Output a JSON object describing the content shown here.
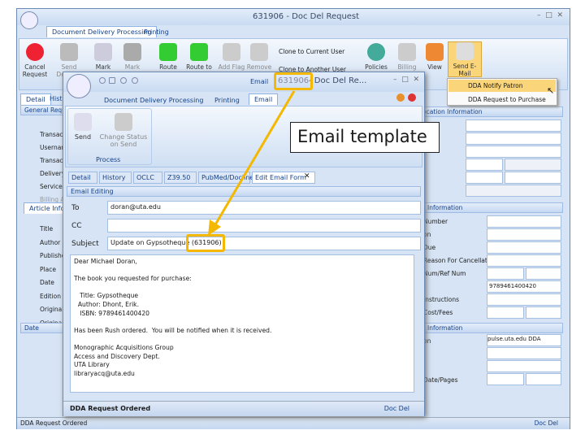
{
  "main_window": {
    "title": "631906 - Doc Del Request",
    "tabs": [
      "Document Delivery Processing",
      "Printing"
    ],
    "ribbon": [
      "Cancel Request",
      "Send Delivery",
      "Mark",
      "Mark Found",
      "Route",
      "Route to",
      "Add Flag",
      "Remove",
      "Policies",
      "Billing",
      "View",
      "Send E-Mail"
    ],
    "clone_current": "Clone to Current User",
    "clone_another": "Clone to Another User",
    "left_tabs": [
      "Detail",
      "History"
    ],
    "left_labels": [
      "General Request",
      "Transaction Number",
      "Username",
      "Transaction Date",
      "Delivery Method",
      "Service Level",
      "Billing Account"
    ],
    "article_tab": "Article Info",
    "article_labels": [
      "Title",
      "Author",
      "Publisher",
      "Place",
      "Date",
      "Edition",
      "Original Loan Author",
      "Original Loan Title"
    ],
    "date_label": "Date",
    "right_sections": [
      "Location Information",
      "Information",
      "Information"
    ],
    "right_labels": [
      "Number",
      "on",
      "Due",
      "Reason For Cancellation",
      "Num/Ref Num",
      "",
      "Instructions",
      "Cost/Fees"
    ],
    "isbn_value": "9789461400420",
    "location_value": "pulse.uta.edu DDA",
    "right_labels2": [
      "on",
      "Date/Pages"
    ],
    "status": "DDA Request Ordered",
    "status_right": "Doc Del"
  },
  "dropdown": {
    "items": [
      "DDA Notify Patron",
      "DDA Request to Purchase"
    ]
  },
  "email_window": {
    "title_context": "Email",
    "title_id": "631906",
    "title_rest": " - Doc Del Re...",
    "tabs": [
      "Document Delivery Processing",
      "Printing",
      "Email"
    ],
    "send": "Send",
    "change_status": "Change Status on Send",
    "group": "Process",
    "subtabs": [
      "Detail",
      "History",
      "OCLC",
      "Z39.50",
      "PubMed/Docline",
      "Edit Email Form"
    ],
    "section": "Email Editing",
    "to_label": "To",
    "to_value": "doran@uta.edu",
    "cc_label": "CC",
    "subject_label": "Subject",
    "subject_value": "Update on Gypsotheque",
    "subject_id": "(631906)",
    "body": "Dear Michael Doran,\n\nThe book you requested for purchase:\n\n   Title: Gypsotheque\n  Author: Dhont, Erik.\n   ISBN: 9789461400420\n\nHas been Rush ordered.  You will be notified when it is received.\n\nMonographic Acquisitions Group\nAccess and Discovery Dept.\nUTA Library\nlibraryacq@uta.edu",
    "status": "DDA Request Ordered",
    "status_right": "Doc Del"
  },
  "callout": "Email template",
  "colors": {
    "highlight": "#f5b800",
    "ribbon": "#d6e4f5"
  }
}
